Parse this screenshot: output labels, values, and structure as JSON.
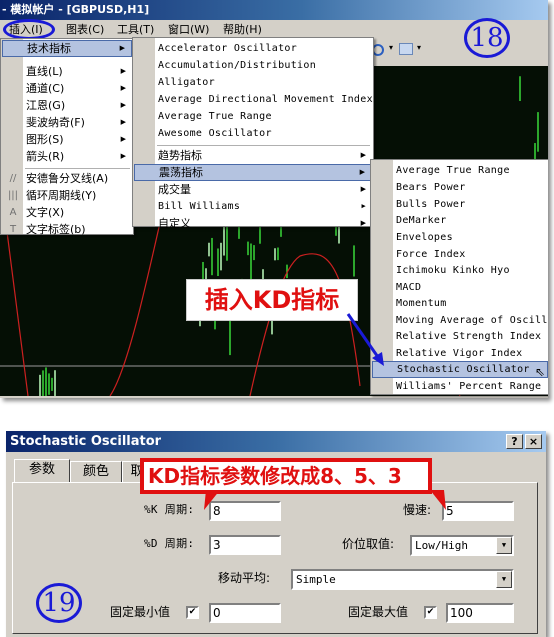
{
  "step18": {
    "window_title": "- 模拟帐户 - [GBPUSD,H1]",
    "step_number": "18",
    "menubar": [
      "插入(I)",
      "图表(C)",
      "工具(T)",
      "窗口(W)",
      "帮助(H)"
    ],
    "insert_menu": {
      "items": [
        {
          "label": "技术指标",
          "submenu": true,
          "selected": true
        },
        {
          "label": "直线(L)",
          "submenu": true
        },
        {
          "label": "通道(C)",
          "submenu": true
        },
        {
          "label": "江恩(G)",
          "submenu": true
        },
        {
          "label": "斐波纳奇(F)",
          "submenu": true
        },
        {
          "label": "图形(S)",
          "submenu": true
        },
        {
          "label": "箭头(R)",
          "submenu": true
        },
        {
          "label": "安德鲁分叉线(A)",
          "icon": "pitchfork-icon"
        },
        {
          "label": "循环周期线(Y)",
          "icon": "cycle-lines-icon"
        },
        {
          "label": "文字(X)",
          "icon": "text-icon"
        },
        {
          "label": "文字标签(b)",
          "icon": "text-label-icon"
        }
      ]
    },
    "indicators_menu": {
      "items": [
        "Accelerator Oscillator",
        "Accumulation/Distribution",
        "Alligator",
        "Average Directional Movement Index",
        "Average True Range",
        "Awesome Oscillator"
      ],
      "groups": [
        {
          "label": "趋势指标",
          "selected": false
        },
        {
          "label": "震荡指标",
          "selected": true
        },
        {
          "label": "成交量",
          "selected": false
        },
        {
          "label": "Bill Williams",
          "selected": false
        },
        {
          "label": "自定义",
          "selected": false
        }
      ]
    },
    "oscillators_menu": {
      "items": [
        "Average True Range",
        "Bears Power",
        "Bulls Power",
        "DeMarker",
        "Envelopes",
        "Force Index",
        "Ichimoku Kinko Hyo",
        "MACD",
        "Momentum",
        "Moving Average of Oscillat",
        "Relative Strength Index",
        "Relative Vigor Index",
        "Stochastic Oscillator",
        "Williams' Percent Range"
      ],
      "selected": "Stochastic Oscillator"
    },
    "annotation": "插入KD指标"
  },
  "step19": {
    "step_number": "19",
    "dialog_title": "Stochastic Oscillator",
    "help_button": "?",
    "close_button": "×",
    "tabs": [
      "参数",
      "颜色",
      "取"
    ],
    "annotation": "KD指标参数修改成8、5、3",
    "fields": {
      "k_period_label": "%K 周期:",
      "k_period_value": "8",
      "slowing_label": "慢速:",
      "slowing_value": "5",
      "d_period_label": "%D 周期:",
      "d_period_value": "3",
      "price_field_label": "价位取值:",
      "price_field_value": "Low/High",
      "ma_method_label": "移动平均:",
      "ma_method_value": "Simple",
      "fixed_min_label": "固定最小值",
      "fixed_min_checked": "✔",
      "fixed_min_value": "0",
      "fixed_max_label": "固定最大值",
      "fixed_max_checked": "✔",
      "fixed_max_value": "100"
    }
  },
  "colors": {
    "annotation_blue": "#1a1ad6",
    "annotation_red": "#e01010",
    "chart_bg": "#050f05",
    "bar_green": "#39d839",
    "ma_red": "#cc2020",
    "menu_highlight": "#b4c3e0"
  }
}
